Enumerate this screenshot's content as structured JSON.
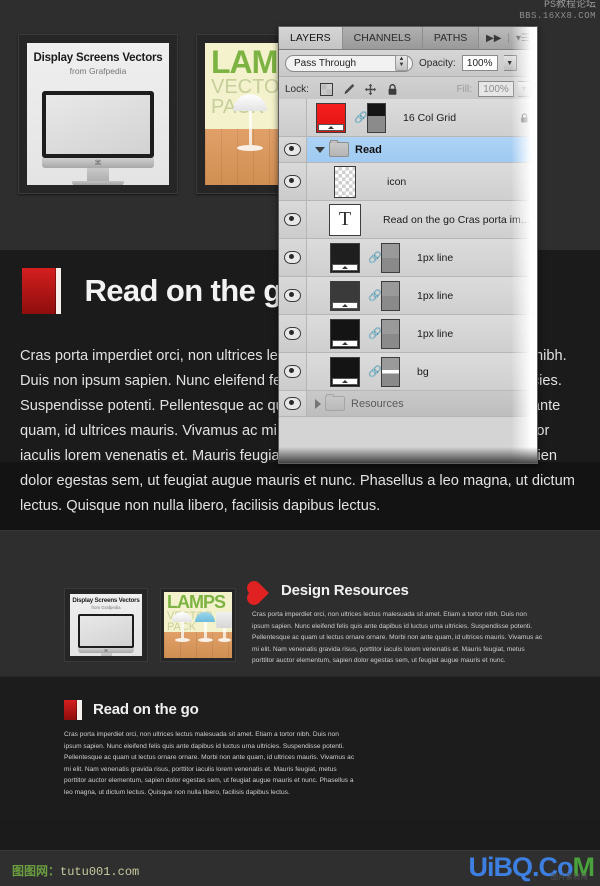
{
  "page": {
    "background_color": "#1b1b1b",
    "band_color": "#2e2e2e"
  },
  "top_section": {
    "thumbnails": [
      {
        "name": "display-screens-vectors",
        "title": "Display Screens Vectors",
        "subtitle": "from Grafpedia",
        "apple_logo": "⌘"
      },
      {
        "name": "lamps-vector-pack",
        "title_line1": "LAMPS",
        "title_line2": "VECTOR PACK",
        "color_green": "#7cb342",
        "color_bg": "#f4f2cd"
      }
    ],
    "heading_partial": "Resources"
  },
  "read_hero": {
    "title": "Read on the go",
    "icon": "red-book-icon",
    "body": "Cras porta imperdiet orci, non ultrices lectus malesuada sit amet. Etiam a tortor nibh. Duis non ipsum sapien. Nunc eleifend felis quis ante dapibus id luctus urna ultricies. Suspendisse potenti. Pellentesque ac quam ut lectus ornare ornare. Morbi non ante quam, id ultrices mauris. Vivamus ac mi elit. Nam venenatis gravida risus, porttitor iaculis lorem venenatis et. Mauris feugiat, metus porttitor auctor elementum, sapien dolor egestas sem, ut feugiat augue mauris et nunc. Phasellus a leo magna, ut dictum lectus. Quisque non nulla libero, facilisis dapibus lectus."
  },
  "design_resources": {
    "title": "Design Resources",
    "icon": "red-heart-icon",
    "body": "Cras porta imperdiet orci, non ultrices lectus malesuada sit amet. Etiam a tortor nibh. Duis non ipsum sapien. Nunc eleifend felis quis ante dapibus id luctus urna ultricies. Suspendisse potenti. Pellentesque ac quam ut lectus ornare ornare. Morbi non ante quam, id ultrices mauris. Vivamus ac mi elit. Nam venenatis gravida risus, porttitor iaculis lorem venenatis et. Mauris feugiat, metus porttitor auctor elementum, sapien dolor egestas sem, ut feugiat augue mauris et nunc."
  },
  "read_small": {
    "title": "Read on the go",
    "icon": "red-book-icon",
    "body": "Cras porta imperdiet orci, non ultrices lectus malesuada sit amet. Etiam a tortor nibh. Duis non ipsum sapien. Nunc eleifend felis quis ante dapibus id luctus urna ultricies. Suspendisse potenti. Pellentesque ac quam ut lectus ornare ornare. Morbi non ante quam, id ultrices mauris. Vivamus ac mi elit. Nam venenatis gravida risus, porttitor iaculis lorem venenatis et. Mauris feugiat, metus porttitor auctor elementum, sapien dolor egestas sem, ut feugiat augue mauris et nunc. Phasellus a leo magna, ut dictum lectus. Quisque non nulla libero, facilisis dapibus lectus."
  },
  "watermarks": {
    "top_line1": "PS教程论坛",
    "top_line2": "BBS.16XX8.COM",
    "bottom_left_cn": "图图网：",
    "bottom_left_en": "tutu001.com",
    "bottom_right_blue": "UiBQ",
    "bottom_right_blue2": ".Co",
    "bottom_right_green": "M",
    "bottom_right_sub": "图片素材网"
  },
  "ps_panel": {
    "tabs": [
      {
        "label": "LAYERS",
        "active": true
      },
      {
        "label": "CHANNELS",
        "active": false
      },
      {
        "label": "PATHS",
        "active": false
      }
    ],
    "tab_arrows_icon": "double-chevron-right-icon",
    "tab_menu_icon": "panel-menu-icon",
    "blend_mode": "Pass Through",
    "opacity_label": "Opacity:",
    "opacity_value": "100%",
    "lock_label": "Lock:",
    "lock_icons": [
      "transparent-pixels-icon",
      "image-pixels-brush-icon",
      "position-move-icon",
      "lock-all-padlock-icon"
    ],
    "fill_label": "Fill:",
    "fill_value": "100%",
    "layers": [
      {
        "name": "16 Col Grid",
        "visible": false,
        "selected": false,
        "thumb": "red-fill",
        "linked": true,
        "mask": "black-gray",
        "locked": true,
        "type": "layer"
      },
      {
        "name": "Read",
        "visible": true,
        "selected": true,
        "type": "group",
        "expanded": true
      },
      {
        "name": "icon",
        "visible": true,
        "selected": false,
        "thumb": "checker",
        "linked": false,
        "type": "layer"
      },
      {
        "name": "Read on the go  Cras porta im...",
        "visible": true,
        "selected": false,
        "thumb": "text-T",
        "linked": false,
        "type": "text"
      },
      {
        "name": "1px line",
        "visible": true,
        "selected": false,
        "thumb": "dark-fill",
        "linked": true,
        "mask": "gray-gray",
        "type": "layer"
      },
      {
        "name": "1px line",
        "visible": true,
        "selected": false,
        "thumb": "dark-fill",
        "linked": true,
        "mask": "gray-gray",
        "type": "layer"
      },
      {
        "name": "1px line",
        "visible": true,
        "selected": false,
        "thumb": "dark-fill",
        "linked": true,
        "mask": "gray-gray",
        "type": "layer"
      },
      {
        "name": "bg",
        "visible": true,
        "selected": false,
        "thumb": "dark-fill",
        "linked": true,
        "mask": "gray-white-gray",
        "type": "layer"
      },
      {
        "name": "Resources",
        "visible": true,
        "selected": false,
        "type": "group",
        "expanded": false
      }
    ]
  }
}
